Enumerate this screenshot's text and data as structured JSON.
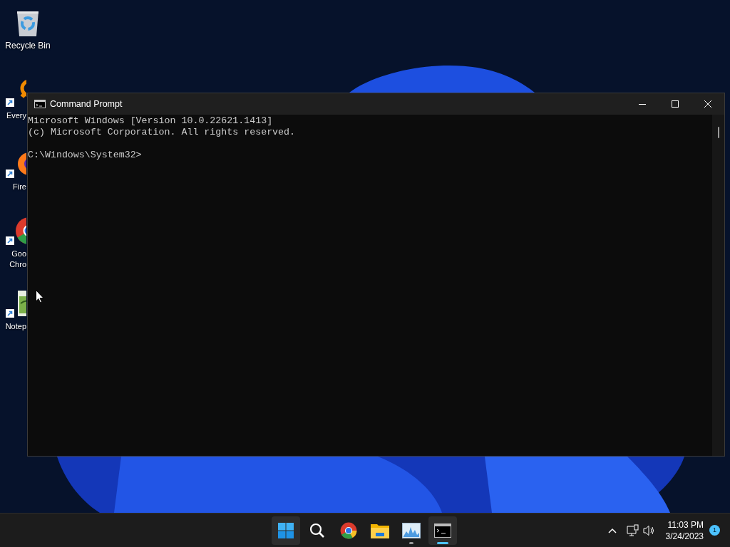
{
  "desktop_icons": [
    {
      "kind": "recycle",
      "lines": [
        "Recycle Bin"
      ],
      "shortcut": false
    },
    {
      "kind": "everything",
      "lines": [
        "Every"
      ],
      "shortcut": true
    },
    {
      "kind": "firefox",
      "lines": [
        "Fire"
      ],
      "shortcut": true
    },
    {
      "kind": "chrome",
      "lines": [
        "Goo",
        "Chro"
      ],
      "shortcut": true
    },
    {
      "kind": "notepad",
      "lines": [
        "Notep"
      ],
      "shortcut": true
    }
  ],
  "window": {
    "title": "Command Prompt",
    "console_blocks": [
      [
        "Microsoft Windows [Version 10.0.22621.1413]",
        "(c) Microsoft Corporation. All rights reserved."
      ],
      [
        "C:\\Windows\\System32>"
      ]
    ]
  },
  "taskbar": {
    "items": [
      {
        "kind": "start",
        "highlighted": true,
        "running": false,
        "selected": false
      },
      {
        "kind": "search",
        "highlighted": false,
        "running": false,
        "selected": false
      },
      {
        "kind": "chrome",
        "highlighted": false,
        "running": false,
        "selected": false
      },
      {
        "kind": "explorer",
        "highlighted": false,
        "running": false,
        "selected": false
      },
      {
        "kind": "monitor",
        "highlighted": false,
        "running": true,
        "selected": false
      },
      {
        "kind": "terminal",
        "highlighted": true,
        "running": true,
        "selected": true
      }
    ],
    "tray": {
      "time": "11:03 PM",
      "date": "3/24/2023",
      "notifications": "1"
    }
  }
}
